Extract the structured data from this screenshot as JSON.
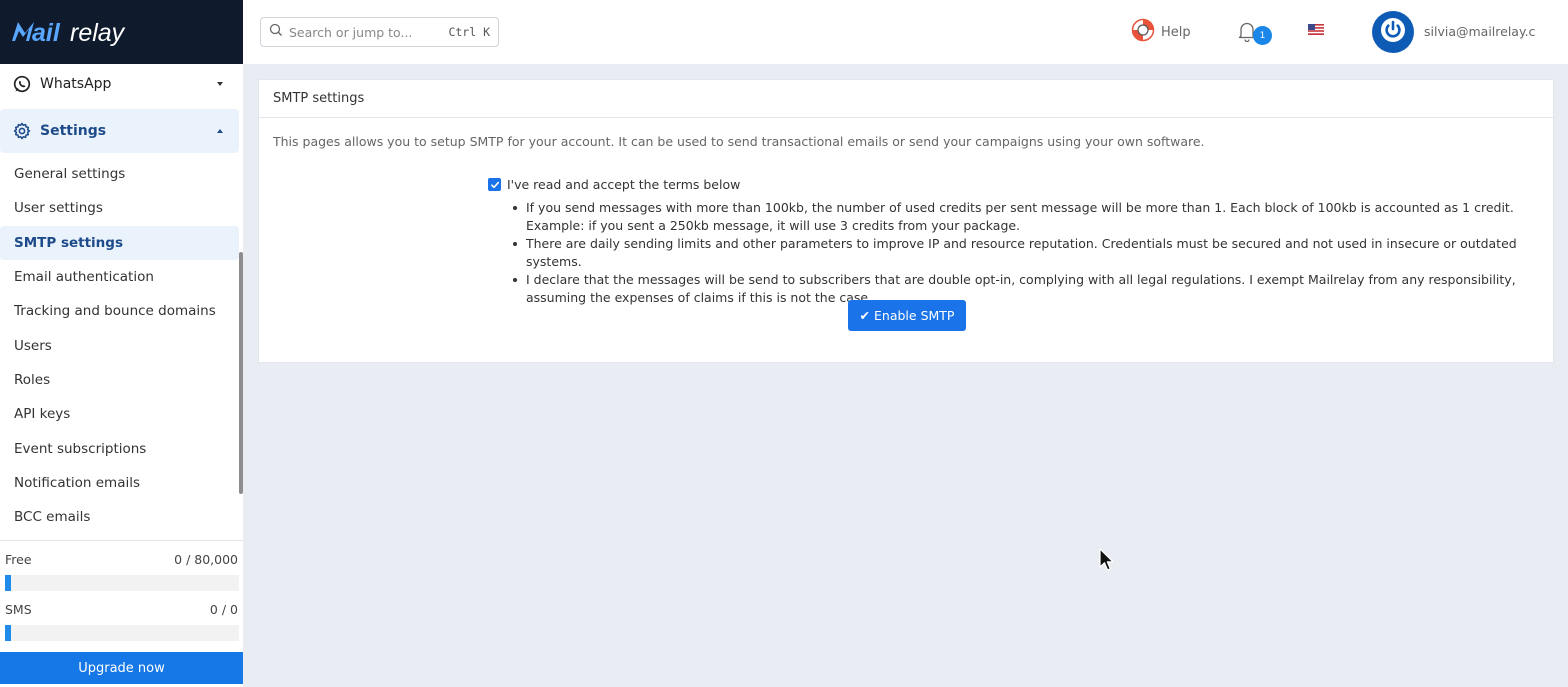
{
  "brand": {
    "logo_text": "Mailrelay",
    "logo_bg": "#0f1b2d"
  },
  "sidebar": {
    "groups": [
      {
        "label": "WhatsApp",
        "icon": "whatsapp-icon",
        "expanded": false
      },
      {
        "label": "Settings",
        "icon": "gear-icon",
        "expanded": true
      }
    ],
    "items": [
      {
        "label": "General settings",
        "active": false
      },
      {
        "label": "User settings",
        "active": false
      },
      {
        "label": "SMTP settings",
        "active": true
      },
      {
        "label": "Email authentication",
        "active": false
      },
      {
        "label": "Tracking and bounce domains",
        "active": false
      },
      {
        "label": "Users",
        "active": false
      },
      {
        "label": "Roles",
        "active": false
      },
      {
        "label": "API keys",
        "active": false
      },
      {
        "label": "Event subscriptions",
        "active": false
      },
      {
        "label": "Notification emails",
        "active": false
      },
      {
        "label": "BCC emails",
        "active": false
      }
    ]
  },
  "plans": [
    {
      "name": "Free",
      "usage": "0 / 80,000",
      "used_fraction": 0
    },
    {
      "name": "SMS",
      "usage": "0 / 0",
      "used_fraction": 0
    }
  ],
  "upgrade_label": "Upgrade now",
  "header": {
    "search_placeholder": "Search or jump to...",
    "search_shortcut": "Ctrl K",
    "help_label": "Help",
    "notification_count": "1",
    "language_flag": "us-flag-icon",
    "user_email": "silvia@mailrelay.com"
  },
  "card": {
    "title": "SMTP settings",
    "description": "This pages allows you to setup SMTP for your account. It can be used to send transactional emails or send your campaigns using your own software.",
    "terms_label": "I've read and accept the terms below",
    "terms_checked": true,
    "terms": [
      "If you send messages with more than 100kb, the number of used credits per sent message will be more than 1. Each block of 100kb is accounted as 1 credit. Example: if you sent a 250kb message, it will use 3 credits from your package.",
      "There are daily sending limits and other parameters to improve IP and resource reputation. Credentials must be secured and not used in insecure or outdated systems.",
      "I declare that the messages will be send to subscribers that are double opt-in, complying with all legal regulations. I exempt Mailrelay from any responsibility, assuming the expenses of claims if this is not the case."
    ],
    "enable_button": "Enable SMTP"
  },
  "colors": {
    "accent": "#1a73e8",
    "active_bg": "#eaf2fb",
    "active_text": "#1e4b8a",
    "page_bg": "#e9ecf3"
  }
}
